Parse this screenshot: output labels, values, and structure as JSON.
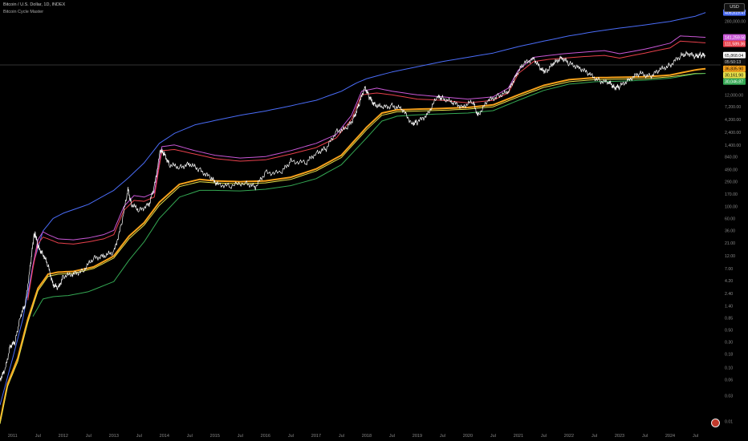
{
  "header": {
    "title": "Bitcoin / U.S. Dollar, 1D, INDEX",
    "indicator": "Bitcoin Cycle Master",
    "currency": "USD"
  },
  "colors": {
    "background": "#000000",
    "price": "#ffffff",
    "blue_band": "#4a6cf7",
    "magenta_band": "#c957d6",
    "red_band": "#e8414c",
    "orange_band": "#f7a21c",
    "yellow_band": "#e6e04a",
    "green_band": "#34a853",
    "axis_text": "#8a8a8a"
  },
  "chart_data": {
    "type": "line",
    "y_scale": "log",
    "ylim": [
      0.008,
      700000
    ],
    "x_range": [
      2010.75,
      2025.0
    ],
    "x_tick_labels": [
      {
        "label": "2011",
        "x": 2011.0
      },
      {
        "label": "Jul",
        "x": 2011.5
      },
      {
        "label": "2012",
        "x": 2012.0
      },
      {
        "label": "Jul",
        "x": 2012.5
      },
      {
        "label": "2013",
        "x": 2013.0
      },
      {
        "label": "Jul",
        "x": 2013.5
      },
      {
        "label": "2014",
        "x": 2014.0
      },
      {
        "label": "Jul",
        "x": 2014.5
      },
      {
        "label": "2015",
        "x": 2015.0
      },
      {
        "label": "Jul",
        "x": 2015.5
      },
      {
        "label": "2016",
        "x": 2016.0
      },
      {
        "label": "Jul",
        "x": 2016.5
      },
      {
        "label": "2017",
        "x": 2017.0
      },
      {
        "label": "Jul",
        "x": 2017.5
      },
      {
        "label": "2018",
        "x": 2018.0
      },
      {
        "label": "Jul",
        "x": 2018.5
      },
      {
        "label": "2019",
        "x": 2019.0
      },
      {
        "label": "Jul",
        "x": 2019.5
      },
      {
        "label": "2020",
        "x": 2020.0
      },
      {
        "label": "Jul",
        "x": 2020.5
      },
      {
        "label": "2021",
        "x": 2021.0
      },
      {
        "label": "Jul",
        "x": 2021.5
      },
      {
        "label": "2022",
        "x": 2022.0
      },
      {
        "label": "Jul",
        "x": 2022.5
      },
      {
        "label": "2023",
        "x": 2023.0
      },
      {
        "label": "Jul",
        "x": 2023.5
      },
      {
        "label": "2024",
        "x": 2024.0
      },
      {
        "label": "Jul",
        "x": 2024.5
      }
    ],
    "y_tick_labels": [
      {
        "label": "280,000.00",
        "v": 280000
      },
      {
        "label": "12,000.00",
        "v": 12000
      },
      {
        "label": "7,200.00",
        "v": 7200
      },
      {
        "label": "4,200.00",
        "v": 4200
      },
      {
        "label": "2,400.00",
        "v": 2400
      },
      {
        "label": "1,400.00",
        "v": 1400
      },
      {
        "label": "840.00",
        "v": 840
      },
      {
        "label": "490.00",
        "v": 490
      },
      {
        "label": "290.00",
        "v": 290
      },
      {
        "label": "170.00",
        "v": 170
      },
      {
        "label": "100.00",
        "v": 100
      },
      {
        "label": "60.00",
        "v": 60
      },
      {
        "label": "36.00",
        "v": 36
      },
      {
        "label": "21.00",
        "v": 21
      },
      {
        "label": "12.00",
        "v": 12
      },
      {
        "label": "7.00",
        "v": 7
      },
      {
        "label": "4.20",
        "v": 4.2
      },
      {
        "label": "2.40",
        "v": 2.4
      },
      {
        "label": "1.40",
        "v": 1.4
      },
      {
        "label": "0.85",
        "v": 0.85
      },
      {
        "label": "0.50",
        "v": 0.5
      },
      {
        "label": "0.30",
        "v": 0.3
      },
      {
        "label": "0.18",
        "v": 0.18
      },
      {
        "label": "0.10",
        "v": 0.1
      },
      {
        "label": "0.06",
        "v": 0.06
      },
      {
        "label": "0.03",
        "v": 0.03
      },
      {
        "label": "0.01",
        "v": 0.01
      }
    ],
    "price_labels": [
      {
        "label": "408,819.47",
        "value": 408819.47,
        "color": "#4a6cf7",
        "text": "#ffffff"
      },
      {
        "label": "141,259.50",
        "value": 141259.5,
        "color": "#c957d6",
        "text": "#ffffff"
      },
      {
        "label": "111,589.36",
        "value": 111589.36,
        "color": "#e8414c",
        "text": "#ffffff"
      },
      {
        "label": "65,868.04",
        "value": 65868.04,
        "color": "#ffffff",
        "text": "#000000"
      },
      {
        "label": "05:50:13",
        "value": 50000,
        "color": "#111111",
        "text": "#dddddd"
      },
      {
        "label": "36,835.90",
        "value": 36835.9,
        "color": "#f7a21c",
        "text": "#000000"
      },
      {
        "label": "30,161.90",
        "value": 30161.9,
        "color": "#e6e04a",
        "text": "#000000"
      },
      {
        "label": "30,046.87",
        "value": 30046.87,
        "color": "#34a853",
        "text": "#ffffff"
      }
    ],
    "series": [
      {
        "color": "#4a6cf7",
        "width": 1,
        "x": [
          2010.75,
          2011.0,
          2011.2,
          2011.4,
          2011.6,
          2011.8,
          2012.0,
          2012.5,
          2013.0,
          2013.3,
          2013.6,
          2013.9,
          2014.2,
          2014.6,
          2015.0,
          2015.5,
          2016.0,
          2016.5,
          2017.0,
          2017.5,
          2017.8,
          2018.0,
          2018.5,
          2019.0,
          2019.5,
          2020.0,
          2020.5,
          2021.0,
          2021.5,
          2022.0,
          2022.5,
          2023.0,
          2023.5,
          2024.0,
          2024.5,
          2024.7
        ],
        "y": [
          0.02,
          0.15,
          0.8,
          8,
          35,
          60,
          75,
          110,
          200,
          350,
          650,
          1500,
          2300,
          3300,
          4000,
          5000,
          6000,
          7500,
          9500,
          14000,
          20000,
          24000,
          32000,
          40000,
          50000,
          60000,
          72000,
          95000,
          120000,
          150000,
          180000,
          210000,
          240000,
          280000,
          350000,
          408819
        ]
      },
      {
        "color": "#c957d6",
        "width": 1,
        "x": [
          2011.3,
          2011.4,
          2011.5,
          2011.6,
          2011.7,
          2011.9,
          2012.2,
          2012.5,
          2012.8,
          2013.0,
          2013.2,
          2013.4,
          2013.6,
          2013.8,
          2013.95,
          2014.2,
          2014.6,
          2015.0,
          2015.5,
          2016.0,
          2016.5,
          2017.0,
          2017.4,
          2017.7,
          2017.9,
          2018.2,
          2018.5,
          2019.0,
          2019.5,
          2020.0,
          2020.5,
          2020.8,
          2021.0,
          2021.3,
          2021.6,
          2021.9,
          2022.3,
          2022.7,
          2023.0,
          2023.5,
          2024.0,
          2024.2,
          2024.5,
          2024.7
        ],
        "y": [
          2,
          8,
          24,
          34,
          30,
          25,
          24,
          26,
          30,
          36,
          100,
          160,
          150,
          180,
          1300,
          1400,
          1100,
          900,
          800,
          850,
          1100,
          1500,
          2200,
          5000,
          14000,
          16000,
          14000,
          12000,
          11000,
          10000,
          11000,
          16000,
          35000,
          60000,
          65000,
          70000,
          75000,
          80000,
          70000,
          85000,
          110000,
          150000,
          145000,
          141259
        ]
      },
      {
        "color": "#e8414c",
        "width": 1,
        "x": [
          2011.3,
          2011.4,
          2011.5,
          2011.6,
          2011.7,
          2011.9,
          2012.2,
          2012.5,
          2012.8,
          2013.0,
          2013.2,
          2013.4,
          2013.6,
          2013.8,
          2013.95,
          2014.2,
          2014.6,
          2015.0,
          2015.5,
          2016.0,
          2016.5,
          2017.0,
          2017.4,
          2017.7,
          2017.9,
          2018.2,
          2018.5,
          2019.0,
          2019.5,
          2020.0,
          2020.5,
          2020.8,
          2021.0,
          2021.3,
          2021.6,
          2021.9,
          2022.3,
          2022.7,
          2023.0,
          2023.5,
          2024.0,
          2024.2,
          2024.5,
          2024.7
        ],
        "y": [
          1.8,
          7,
          20,
          27,
          25,
          21,
          20,
          22,
          25,
          30,
          85,
          130,
          125,
          150,
          1100,
          1150,
          950,
          780,
          700,
          740,
          950,
          1250,
          1900,
          4200,
          12000,
          13000,
          12000,
          10000,
          9500,
          8500,
          9500,
          13000,
          30000,
          50000,
          55000,
          58000,
          62000,
          65000,
          58000,
          72000,
          90000,
          120000,
          115000,
          111589
        ]
      },
      {
        "color": "#f7a21c",
        "width": 2,
        "x": [
          2010.75,
          2010.9,
          2011.1,
          2011.3,
          2011.5,
          2011.7,
          2011.9,
          2012.2,
          2012.6,
          2013.0,
          2013.3,
          2013.6,
          2013.9,
          2014.3,
          2014.7,
          2015.0,
          2015.5,
          2016.0,
          2016.5,
          2017.0,
          2017.5,
          2018.0,
          2018.3,
          2018.6,
          2019.0,
          2019.5,
          2020.0,
          2020.5,
          2021.0,
          2021.5,
          2022.0,
          2022.5,
          2023.0,
          2023.5,
          2024.0,
          2024.5,
          2024.7
        ],
        "y": [
          0.01,
          0.05,
          0.15,
          0.8,
          3,
          5.5,
          6,
          6.2,
          7.5,
          12,
          28,
          50,
          120,
          260,
          320,
          300,
          290,
          300,
          350,
          500,
          900,
          3000,
          5500,
          6300,
          6500,
          6700,
          7000,
          7800,
          12000,
          18000,
          23000,
          25000,
          25500,
          26000,
          28000,
          35000,
          36835
        ]
      },
      {
        "color": "#e6e04a",
        "width": 1,
        "x": [
          2010.75,
          2010.9,
          2011.1,
          2011.3,
          2011.5,
          2011.7,
          2011.9,
          2012.2,
          2012.6,
          2013.0,
          2013.3,
          2013.6,
          2013.9,
          2014.3,
          2014.7,
          2015.0,
          2015.5,
          2016.0,
          2016.5,
          2017.0,
          2017.5,
          2018.0,
          2018.3,
          2018.6,
          2019.0,
          2019.5,
          2020.0,
          2020.5,
          2021.0,
          2021.5,
          2022.0,
          2022.5,
          2023.0,
          2023.5,
          2024.0,
          2024.5,
          2024.7
        ],
        "y": [
          0.009,
          0.045,
          0.13,
          0.7,
          2.7,
          5,
          5.5,
          5.7,
          7,
          11,
          25,
          45,
          105,
          235,
          290,
          275,
          265,
          275,
          320,
          460,
          820,
          2700,
          5000,
          5800,
          6000,
          6200,
          6500,
          7200,
          11000,
          16500,
          21000,
          23000,
          23500,
          24000,
          26000,
          30000,
          30161
        ]
      },
      {
        "color": "#34a853",
        "width": 1,
        "x": [
          2011.4,
          2011.6,
          2011.8,
          2012.1,
          2012.5,
          2013.0,
          2013.3,
          2013.6,
          2013.9,
          2014.3,
          2014.7,
          2015.0,
          2015.5,
          2016.0,
          2016.5,
          2017.0,
          2017.5,
          2018.0,
          2018.3,
          2018.6,
          2019.0,
          2019.5,
          2020.0,
          2020.5,
          2021.0,
          2021.5,
          2022.0,
          2022.5,
          2023.0,
          2023.5,
          2024.0,
          2024.5,
          2024.7
        ],
        "y": [
          0.9,
          1.9,
          2.1,
          2.2,
          2.6,
          4,
          10,
          22,
          60,
          150,
          200,
          200,
          195,
          210,
          245,
          330,
          600,
          1900,
          3900,
          4800,
          5100,
          5300,
          5500,
          6100,
          9500,
          14500,
          19000,
          21000,
          21500,
          22500,
          24500,
          29500,
          30046
        ]
      },
      {
        "color": "#ffffff",
        "width": 0.7,
        "jitter": true,
        "x": [
          2010.75,
          2010.85,
          2010.95,
          2011.05,
          2011.15,
          2011.25,
          2011.35,
          2011.42,
          2011.45,
          2011.5,
          2011.6,
          2011.7,
          2011.8,
          2011.9,
          2012.0,
          2012.2,
          2012.4,
          2012.6,
          2012.8,
          2013.0,
          2013.15,
          2013.28,
          2013.35,
          2013.5,
          2013.7,
          2013.8,
          2013.92,
          2014.0,
          2014.1,
          2014.3,
          2014.5,
          2014.7,
          2014.9,
          2015.05,
          2015.3,
          2015.6,
          2015.8,
          2016.0,
          2016.3,
          2016.5,
          2016.8,
          2017.0,
          2017.2,
          2017.4,
          2017.6,
          2017.75,
          2017.85,
          2017.96,
          2018.05,
          2018.15,
          2018.3,
          2018.5,
          2018.7,
          2018.9,
          2019.0,
          2019.2,
          2019.4,
          2019.5,
          2019.7,
          2019.9,
          2020.1,
          2020.2,
          2020.4,
          2020.6,
          2020.8,
          2020.95,
          2021.1,
          2021.3,
          2021.45,
          2021.55,
          2021.7,
          2021.85,
          2022.0,
          2022.2,
          2022.4,
          2022.6,
          2022.8,
          2022.9,
          2023.0,
          2023.2,
          2023.4,
          2023.6,
          2023.8,
          2024.0,
          2024.2,
          2024.35,
          2024.5,
          2024.6,
          2024.7
        ],
        "y": [
          0.06,
          0.09,
          0.25,
          0.3,
          0.9,
          1.5,
          8,
          28,
          31,
          18,
          13,
          8,
          3.5,
          3,
          5,
          5.5,
          6.5,
          11,
          12,
          14,
          45,
          210,
          110,
          85,
          110,
          230,
          1100,
          950,
          600,
          540,
          620,
          480,
          350,
          260,
          240,
          280,
          230,
          430,
          420,
          700,
          650,
          1000,
          1200,
          2500,
          2800,
          4500,
          8000,
          17000,
          11000,
          8000,
          7000,
          7500,
          6500,
          3500,
          3700,
          5200,
          11000,
          10500,
          8500,
          7300,
          9000,
          5000,
          9300,
          11500,
          13500,
          28000,
          45000,
          58000,
          35000,
          33000,
          46000,
          60000,
          46000,
          39000,
          29000,
          22000,
          20000,
          16500,
          17000,
          24000,
          30000,
          26500,
          35000,
          43000,
          63000,
          72000,
          62000,
          66000,
          65868
        ]
      }
    ]
  }
}
